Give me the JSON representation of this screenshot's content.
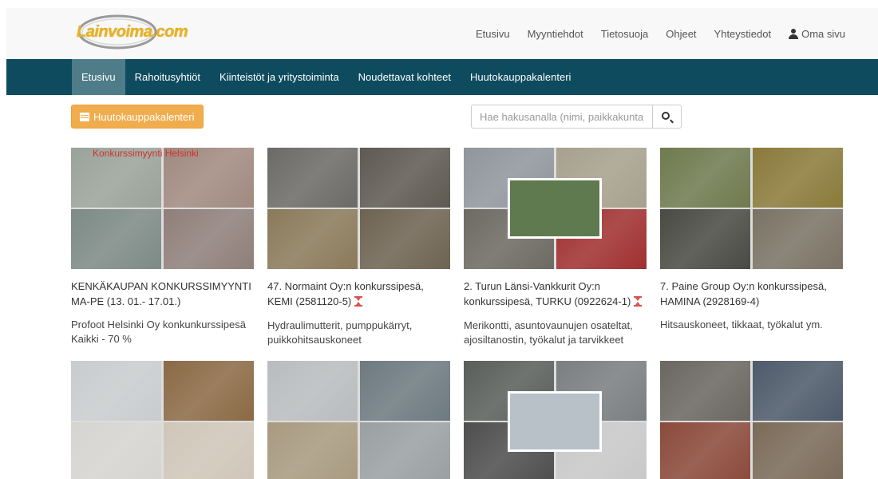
{
  "logo": {
    "text": "Lainvoima.com"
  },
  "top_nav": [
    {
      "label": "Etusivu"
    },
    {
      "label": "Myyntiehdot"
    },
    {
      "label": "Tietosuoja"
    },
    {
      "label": "Ohjeet"
    },
    {
      "label": "Yhteystiedot"
    },
    {
      "label": "Oma sivu",
      "icon": "user-icon"
    }
  ],
  "sec_nav": [
    {
      "label": "Etusivu",
      "active": true
    },
    {
      "label": "Rahoitusyhtiöt"
    },
    {
      "label": "Kiinteistöt ja yritystoiminta"
    },
    {
      "label": "Noudettavat kohteet"
    },
    {
      "label": "Huutokauppakalenteri"
    }
  ],
  "calendar_button": {
    "label": "Huutokauppakalenteri",
    "icon": "calendar-icon"
  },
  "search": {
    "placeholder": "Hae hakusanalla (nimi, paikkakunta)",
    "value": "",
    "icon": "search-icon"
  },
  "colors": {
    "nav_bg": "#0e4b5e",
    "nav_active": "#4e7c88",
    "accent_orange": "#f0ad4e",
    "timer_red": "#d9534f",
    "logo_gold": "#e8b320"
  },
  "cards": [
    {
      "thumb_caption": "Konkurssimyynti Helsinki",
      "title": "KENKÄKAUPAN KONKURSSIMYYNTI MA-PE (13. 01.- 17.01.)",
      "timer": false,
      "description": "Profoot Helsinki Oy konkunkurssipesä Kaikki - 70 %",
      "tile_colors": [
        "#9aa39a",
        "#a08a80",
        "#7d8a86",
        "#8f7f7a"
      ]
    },
    {
      "thumb_caption": "",
      "title": "47. Normaint Oy:n konkurssipesä, KEMI (2581120-5)",
      "timer": true,
      "description": "Hydraulimutterit, pumppukärryt, puikkohitsauskoneet",
      "tile_colors": [
        "#6b6a66",
        "#5e5a52",
        "#8a7a5a",
        "#6e6352"
      ]
    },
    {
      "thumb_caption": "",
      "title": "2. Turun Länsi-Vankkurit Oy:n konkurssipesä, TURKU (0922624-1)",
      "timer": true,
      "description": "Merikontti, asuntovaunujen osateltat, ajosiltanostin, työkalut ja tarvikkeet",
      "tile_colors": [
        "#8f969c",
        "#a7a08d",
        "#6d6a62",
        "#a03030"
      ]
    },
    {
      "thumb_caption": "",
      "title": "7. Paine Group Oy:n konkurssipesä, HAMINA (2928169-4)",
      "timer": false,
      "description": "Hitsauskoneet, tikkaat, työkalut ym.",
      "tile_colors": [
        "#6f7a4e",
        "#8a7a3a",
        "#4a4a44",
        "#7a7264"
      ]
    },
    {
      "thumb_caption": "",
      "title": "",
      "timer": false,
      "description": "",
      "tile_colors": [
        "#c9ccce",
        "#8b6a45",
        "#d6d4d0",
        "#cfc6b8"
      ]
    },
    {
      "thumb_caption": "",
      "title": "",
      "timer": false,
      "description": "",
      "tile_colors": [
        "#b9bcbe",
        "#6d7a80",
        "#a89a80",
        "#9aa0a2"
      ]
    },
    {
      "thumb_caption": "",
      "title": "",
      "timer": false,
      "description": "",
      "tile_colors": [
        "#5a5e5a",
        "#7a7e80",
        "#4e4e4e",
        "#c8c8c8"
      ]
    },
    {
      "thumb_caption": "",
      "title": "",
      "timer": false,
      "description": "",
      "tile_colors": [
        "#6a6660",
        "#4e5a6a",
        "#8a4a3a",
        "#7a6a58"
      ]
    }
  ]
}
